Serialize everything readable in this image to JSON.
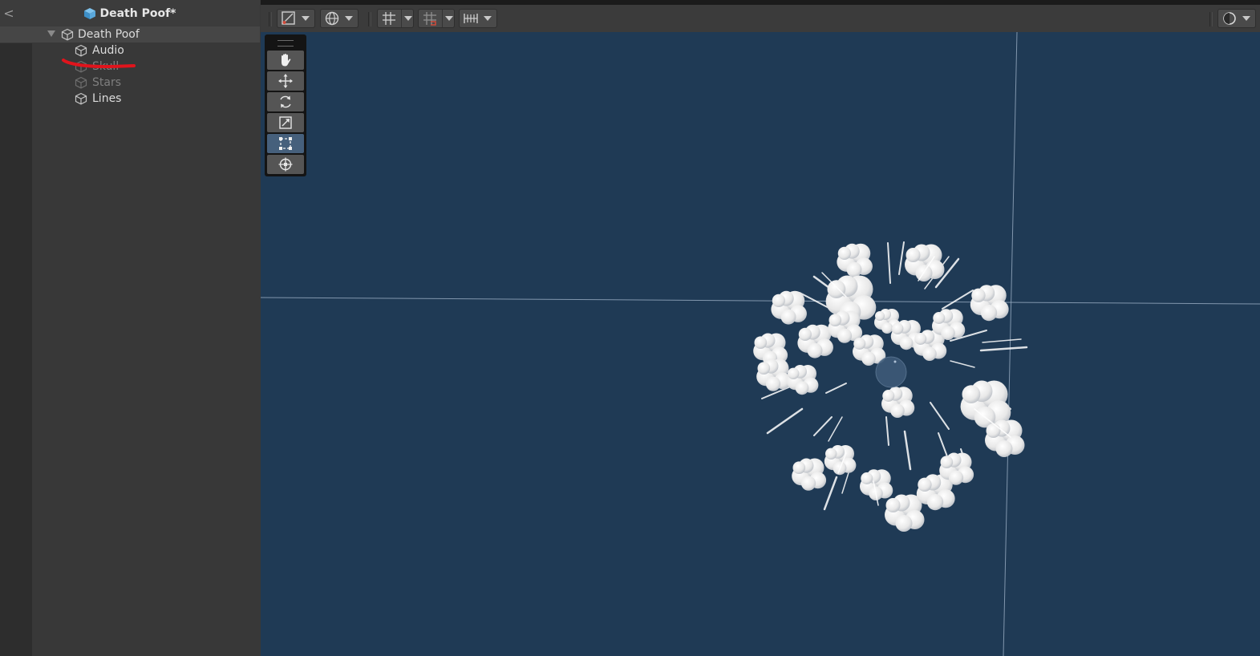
{
  "hierarchy": {
    "back_glyph": "<",
    "prefab_title": "Death Poof*",
    "root": {
      "label": "Death Poof",
      "expanded": true
    },
    "children": [
      {
        "label": "Audio",
        "active": true
      },
      {
        "label": "Skull",
        "active": false
      },
      {
        "label": "Stars",
        "active": false
      },
      {
        "label": "Lines",
        "active": true
      }
    ]
  },
  "scene_toolbar": {
    "buttons": [
      {
        "name": "gizmo-toggle",
        "icon": "gizmo-icon",
        "has_dropdown": true
      },
      {
        "name": "global-toggle",
        "icon": "globe-icon",
        "has_dropdown": true
      },
      {
        "name": "grid-snapping",
        "icon": "grid-icon",
        "has_dropdown": true
      },
      {
        "name": "increment-snap",
        "icon": "snap-grid-icon",
        "has_dropdown": true
      },
      {
        "name": "align-tools",
        "icon": "ruler-icon",
        "has_dropdown": true
      },
      {
        "name": "draw-mode",
        "icon": "shading-circle-icon",
        "has_dropdown": true
      }
    ]
  },
  "tools": [
    {
      "name": "hand-tool",
      "icon": "hand-icon",
      "active": false
    },
    {
      "name": "move-tool",
      "icon": "move-arrows-icon",
      "active": false
    },
    {
      "name": "rotate-tool",
      "icon": "rotate-icon",
      "active": false
    },
    {
      "name": "scale-tool",
      "icon": "scale-icon",
      "active": false
    },
    {
      "name": "rect-tool",
      "icon": "rect-transform-icon",
      "active": true
    },
    {
      "name": "transform-tool",
      "icon": "transform-icon",
      "active": false
    }
  ],
  "colors": {
    "scene_background": "#1f3a55",
    "panel_background": "#383838",
    "selected_row": "#464646",
    "annotation_red": "#e0141c",
    "smoke_white": "#f2f2f2",
    "axis_line": "#9aaec4"
  },
  "annotation": {
    "type": "red strike-through line",
    "target": "Skull"
  }
}
